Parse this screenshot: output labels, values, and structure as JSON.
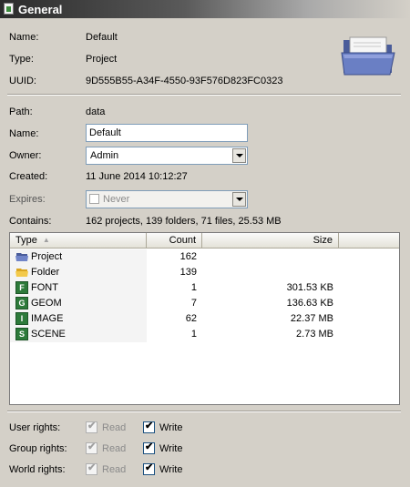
{
  "window": {
    "title": "General"
  },
  "info": {
    "name_label": "Name:",
    "name_value": "Default",
    "type_label": "Type:",
    "type_value": "Project",
    "uuid_label": "UUID:",
    "uuid_value": "9D555B55-A34F-4550-93F576D823FC0323"
  },
  "details": {
    "path_label": "Path:",
    "path_value": "data",
    "name_label": "Name:",
    "name_input": "Default",
    "owner_label": "Owner:",
    "owner_value": "Admin",
    "created_label": "Created:",
    "created_value": "11 June 2014 10:12:27",
    "expires_label": "Expires:",
    "expires_value": "Never",
    "contains_label": "Contains:",
    "contains_value": "162 projects, 139 folders, 71 files, 25.53 MB"
  },
  "table": {
    "columns": [
      "Type",
      "Count",
      "Size"
    ],
    "rows": [
      {
        "icon": "project-folder-icon",
        "type": "Project",
        "count": "162",
        "size": ""
      },
      {
        "icon": "folder-icon",
        "type": "Folder",
        "count": "139",
        "size": ""
      },
      {
        "icon": "font-file-icon",
        "letter": "F",
        "type": "FONT",
        "count": "1",
        "size": "301.53 KB"
      },
      {
        "icon": "geom-file-icon",
        "letter": "G",
        "type": "GEOM",
        "count": "7",
        "size": "136.63 KB"
      },
      {
        "icon": "image-file-icon",
        "letter": "I",
        "type": "IMAGE",
        "count": "62",
        "size": "22.37 MB"
      },
      {
        "icon": "scene-file-icon",
        "letter": "S",
        "type": "SCENE",
        "count": "1",
        "size": "2.73 MB"
      }
    ]
  },
  "rights": {
    "read_label": "Read",
    "write_label": "Write",
    "rows": [
      {
        "label": "User rights:",
        "read": true,
        "read_enabled": false,
        "write": true
      },
      {
        "label": "Group rights:",
        "read": true,
        "read_enabled": false,
        "write": true
      },
      {
        "label": "World rights:",
        "read": true,
        "read_enabled": false,
        "write": true
      }
    ]
  },
  "colors": {
    "background": "#d4d0c8",
    "file_icon_green": "#2d7a3a",
    "folder_blue": "#5a6fb0",
    "folder_yellow": "#f0c040"
  }
}
